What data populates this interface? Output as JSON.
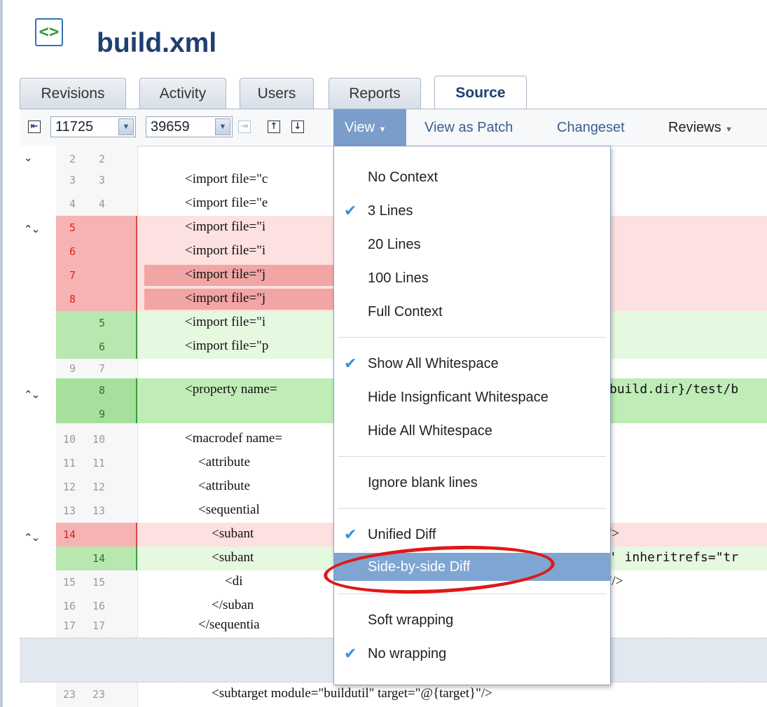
{
  "header": {
    "icon": "xml-code-icon",
    "title": "build.xml"
  },
  "tabs": [
    {
      "label": "Revisions"
    },
    {
      "label": "Activity"
    },
    {
      "label": "Users"
    },
    {
      "label": "Reports"
    },
    {
      "label": "Source",
      "active": true
    }
  ],
  "toolbar": {
    "from_revision": "11725",
    "to_revision": "39659",
    "view_label": "View",
    "view_as_patch": "View as Patch",
    "changeset": "Changeset",
    "reviews": "Reviews"
  },
  "diff_rows": [
    {
      "old": "2",
      "new": "2",
      "code": "",
      "type": "ctx"
    },
    {
      "old": "3",
      "new": "3",
      "code": "<import file=\"c",
      "type": "ctx"
    },
    {
      "old": "4",
      "new": "4",
      "code": "<import file=\"e",
      "type": "ctx"
    },
    {
      "old": "5",
      "new": "",
      "code": "<import file=\"i",
      "type": "del"
    },
    {
      "old": "6",
      "new": "",
      "code": "<import file=\"i",
      "type": "del"
    },
    {
      "old": "7",
      "new": "",
      "code": "<import file=\"j",
      "type": "del"
    },
    {
      "old": "8",
      "new": "",
      "code": "<import file=\"j",
      "type": "del"
    },
    {
      "old": "",
      "new": "5",
      "code": "<import file=\"i",
      "type": "add"
    },
    {
      "old": "",
      "new": "6",
      "code": "<import file=\"p",
      "type": "add"
    },
    {
      "old": "9",
      "new": "7",
      "code": "",
      "type": "ctx"
    },
    {
      "old": "",
      "new": "8",
      "code": "<property name=",
      "type": "addstrong",
      "right_code": "build.dir}/test/b"
    },
    {
      "old": "",
      "new": "9",
      "code": "",
      "type": "addstrong"
    },
    {
      "old": "10",
      "new": "10",
      "code": "<macrodef name=",
      "type": "ctx"
    },
    {
      "old": "11",
      "new": "11",
      "code": "    <attribute ",
      "type": "ctx"
    },
    {
      "old": "12",
      "new": "12",
      "code": "    <attribute ",
      "type": "ctx"
    },
    {
      "old": "13",
      "new": "13",
      "code": "    <sequential",
      "type": "ctx"
    },
    {
      "old": "14",
      "new": "",
      "code": "        <subant",
      "type": "del",
      "right_code": "'>"
    },
    {
      "old": "",
      "new": "14",
      "code": "        <subant",
      "type": "add",
      "right_code": "' inheritrefs=\"tr"
    },
    {
      "old": "15",
      "new": "15",
      "code": "            <di",
      "type": "ctx",
      "right_code": "'/>"
    },
    {
      "old": "16",
      "new": "16",
      "code": "        </suban",
      "type": "ctx"
    },
    {
      "old": "17",
      "new": "17",
      "code": "    </sequentia",
      "type": "ctx"
    },
    {
      "old": "23",
      "new": "23",
      "code": "        <subtarget module=\"buildutil\" target=\"@{target}\"/>",
      "type": "ctx"
    }
  ],
  "view_menu": {
    "items": [
      {
        "label": "No Context",
        "checked": false
      },
      {
        "label": "3 Lines",
        "checked": true
      },
      {
        "label": "20 Lines",
        "checked": false
      },
      {
        "label": "100 Lines",
        "checked": false
      },
      {
        "label": "Full Context",
        "checked": false
      },
      {
        "label": "Show All Whitespace",
        "checked": true
      },
      {
        "label": "Hide Insignficant Whitespace",
        "checked": false
      },
      {
        "label": "Hide All Whitespace",
        "checked": false
      },
      {
        "label": "Ignore blank lines",
        "checked": false
      },
      {
        "label": "Unified Diff",
        "checked": true
      },
      {
        "label": "Side-by-side Diff",
        "checked": false,
        "hover": true
      },
      {
        "label": "Soft wrapping",
        "checked": false
      },
      {
        "label": "No wrapping",
        "checked": true
      }
    ]
  },
  "annotation": {
    "color": "#e01818",
    "target": "Side-by-side Diff"
  }
}
